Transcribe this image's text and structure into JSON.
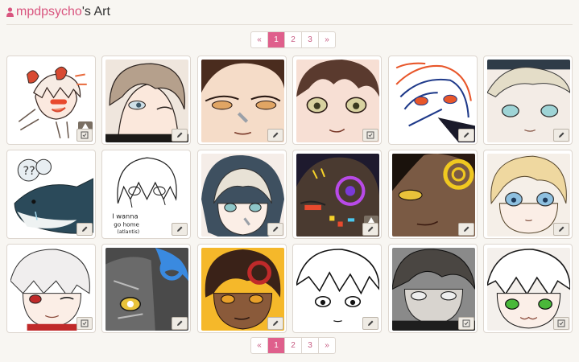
{
  "header": {
    "username": "mpdpsycho",
    "title_suffix": "'s Art",
    "accent_color": "#d9557f"
  },
  "pagination": {
    "prev": "«",
    "pages": [
      "1",
      "2",
      "3"
    ],
    "next": "»",
    "current": "1"
  },
  "gallery": {
    "tiles": [
      {
        "badge": "checkbox-icon",
        "warning": true
      },
      {
        "badge": "pencil-icon"
      },
      {
        "badge": "pencil-icon"
      },
      {
        "badge": "checkbox-icon"
      },
      {
        "badge": "pencil-icon"
      },
      {
        "badge": "pencil-icon"
      },
      {
        "badge": "pencil-icon"
      },
      {
        "badge": "pencil-icon"
      },
      {
        "badge": "pencil-icon"
      },
      {
        "badge": "pencil-icon",
        "warning": true
      },
      {
        "badge": "pencil-icon"
      },
      {
        "badge": "pencil-icon"
      },
      {
        "badge": "checkbox-icon"
      },
      {
        "badge": "pencil-icon"
      },
      {
        "badge": "pencil-icon"
      },
      {
        "badge": "pencil-icon"
      },
      {
        "badge": "checkbox-icon"
      },
      {
        "badge": "checkbox-icon"
      }
    ]
  }
}
